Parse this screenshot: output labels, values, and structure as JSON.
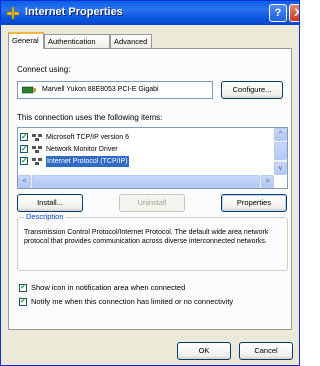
{
  "window": {
    "title": "Internet Properties",
    "help_glyph": "?",
    "close_glyph": "X"
  },
  "tabs": [
    {
      "label": "General",
      "active": true
    },
    {
      "label": "Authentication",
      "active": false
    },
    {
      "label": "Advanced",
      "active": false
    }
  ],
  "connect_using": {
    "label": "Connect using:",
    "adapter": "Marvell Yukon 88E8053 PCI-E Gigabi",
    "configure_button": "Configure..."
  },
  "items_label": "This connection uses the following items:",
  "items": [
    {
      "label": "Microsoft TCP/IP version 6",
      "checked": true,
      "selected": false
    },
    {
      "label": "Network Monitor Driver",
      "checked": true,
      "selected": false
    },
    {
      "label": "Internet Protocol (TCP/IP)",
      "checked": true,
      "selected": true
    }
  ],
  "scroll": {
    "up": "^",
    "down": "v",
    "left": "<",
    "right": ">"
  },
  "buttons": {
    "install": "Install...",
    "uninstall": "Uninstall",
    "properties": "Properties"
  },
  "description": {
    "title": "Description",
    "text": "Transmission Control Protocol/Internet Protocol. The default wide area network protocol that provides communication across diverse interconnected networks."
  },
  "options": [
    {
      "label": "Show icon in notification area when connected",
      "checked": true
    },
    {
      "label": "Notify me when this connection has limited or no connectivity",
      "checked": true
    }
  ],
  "footer": {
    "ok": "OK",
    "cancel": "Cancel"
  },
  "colors": {
    "titlebar": "#0a5fe8",
    "selection": "#316ac5",
    "group_title": "#0046d5",
    "dialog_bg": "#ece9d8"
  }
}
